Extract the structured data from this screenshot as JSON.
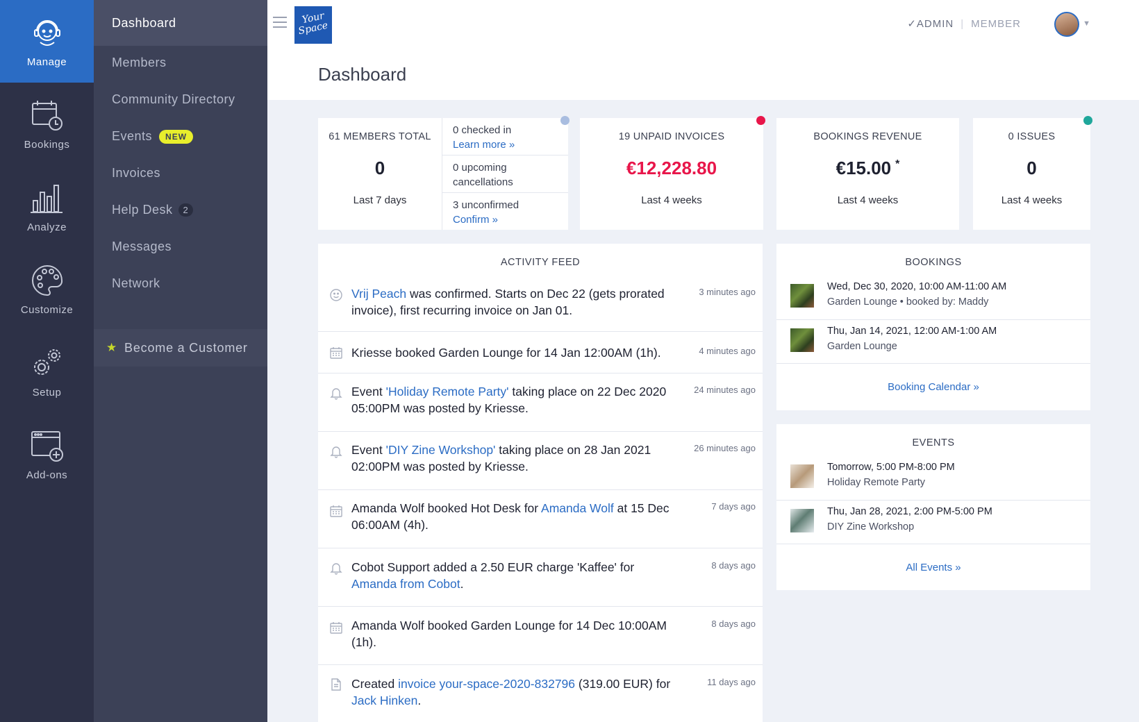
{
  "rail": [
    {
      "label": "Manage",
      "icon": "support-agent-icon"
    },
    {
      "label": "Bookings",
      "icon": "calendar-clock-icon"
    },
    {
      "label": "Analyze",
      "icon": "bar-chart-icon"
    },
    {
      "label": "Customize",
      "icon": "palette-icon"
    },
    {
      "label": "Setup",
      "icon": "gears-icon"
    },
    {
      "label": "Add-ons",
      "icon": "window-add-icon"
    }
  ],
  "subnav": {
    "items": [
      {
        "label": "Dashboard"
      },
      {
        "label": "Members"
      },
      {
        "label": "Community Directory"
      },
      {
        "label": "Events",
        "badge": "NEW"
      },
      {
        "label": "Invoices"
      },
      {
        "label": "Help Desk",
        "count": "2"
      },
      {
        "label": "Messages"
      },
      {
        "label": "Network"
      }
    ],
    "cta": "Become a Customer"
  },
  "topbar": {
    "logo_line1": "Your",
    "logo_line2": "Space",
    "admin": "ADMIN",
    "admin_check": "✓",
    "member": "MEMBER",
    "sep": "|"
  },
  "page": {
    "title": "Dashboard"
  },
  "stats": {
    "members": {
      "label": "61 MEMBERS TOTAL",
      "value": "0",
      "sub": "Last 7 days"
    },
    "checks": [
      {
        "text": "0 checked in",
        "link": "Learn more »"
      },
      {
        "text": "0 upcoming cancellations",
        "link": ""
      },
      {
        "text": "3 unconfirmed",
        "link": "Confirm »"
      }
    ],
    "invoices": {
      "label": "19 UNPAID INVOICES",
      "value": "€12,228.80",
      "sub": "Last 4 weeks"
    },
    "revenue": {
      "label": "BOOKINGS REVENUE",
      "value": "€15.00",
      "mark": "*",
      "sub": "Last 4 weeks"
    },
    "issues": {
      "label": "0 ISSUES",
      "value": "0",
      "sub": "Last 4 weeks"
    },
    "colors": {
      "checks_dot": "#a9bde0",
      "invoices_dot": "#e8164a",
      "issues_dot": "#1fa79b",
      "invoice_value": "#e8164a"
    }
  },
  "feed": {
    "title": "ACTIVITY FEED",
    "items": [
      {
        "icon": "smiley-icon",
        "link1": "Vrij Peach",
        "text1": " was confirmed. Starts on Dec 22 (gets prorated invoice), first recurring invoice on Jan 01.",
        "link2": "",
        "text2": "",
        "time": "3 minutes ago"
      },
      {
        "icon": "calendar-icon",
        "link1": "",
        "text1": "Kriesse booked Garden Lounge for 14 Jan 12:00AM (1h).",
        "link2": "",
        "text2": "",
        "time": "4 minutes ago"
      },
      {
        "icon": "bell-icon",
        "pre": "Event ",
        "link1": "'Holiday Remote Party'",
        "text1": " taking place on 22 Dec 2020 05:00PM was posted by Kriesse.",
        "link2": "",
        "text2": "",
        "time": "24 minutes ago"
      },
      {
        "icon": "bell-icon",
        "pre": "Event ",
        "link1": "'DIY Zine Workshop'",
        "text1": " taking place on 28 Jan 2021 02:00PM was posted by Kriesse.",
        "link2": "",
        "text2": "",
        "time": "26 minutes ago"
      },
      {
        "icon": "calendar-icon",
        "pre": "Amanda Wolf booked Hot Desk for ",
        "link1": "Amanda Wolf",
        "text1": " at 15 Dec 06:00AM (4h).",
        "link2": "",
        "text2": "",
        "time": "7 days ago"
      },
      {
        "icon": "bell-icon",
        "pre": "Cobot Support added a 2.50 EUR charge 'Kaffee' for ",
        "link1": "Amanda from Cobot",
        "text1": ".",
        "link2": "",
        "text2": "",
        "time": "8 days ago"
      },
      {
        "icon": "calendar-icon",
        "pre": "",
        "link1": "",
        "text1": "Amanda Wolf booked Garden Lounge for 14 Dec 10:00AM (1h).",
        "link2": "",
        "text2": "",
        "time": "8 days ago"
      },
      {
        "icon": "document-icon",
        "pre": "Created ",
        "link1": "invoice your-space-2020-832796",
        "text1": " (319.00 EUR) for ",
        "link2": "Jack Hinken",
        "text2": ".",
        "time": "11 days ago"
      }
    ]
  },
  "bookings": {
    "title": "BOOKINGS",
    "items": [
      {
        "title": "Wed, Dec 30, 2020, 10:00 AM-11:00 AM",
        "sub": "Garden Lounge • booked by: Maddy"
      },
      {
        "title": "Thu, Jan 14, 2021, 12:00 AM-1:00 AM",
        "sub": "Garden Lounge"
      }
    ],
    "link": "Booking Calendar »"
  },
  "events": {
    "title": "EVENTS",
    "items": [
      {
        "title": "Tomorrow, 5:00 PM-8:00 PM",
        "sub": "Holiday Remote Party"
      },
      {
        "title": "Thu, Jan 28, 2021, 2:00 PM-5:00 PM",
        "sub": "DIY Zine Workshop"
      }
    ],
    "link": "All Events »"
  }
}
